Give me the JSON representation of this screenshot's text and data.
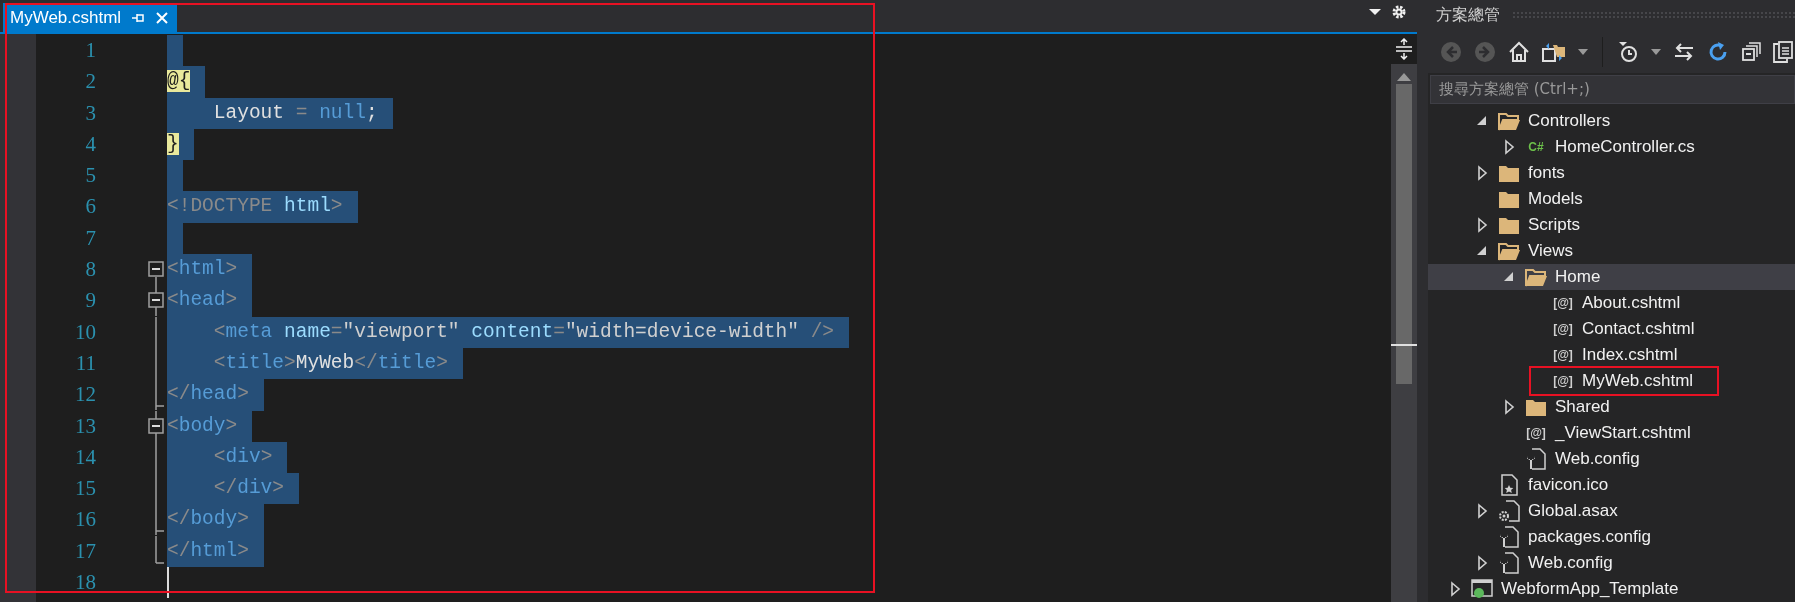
{
  "editor": {
    "tabs": [
      {
        "label": "MyWeb.cshtml",
        "selected": true
      }
    ],
    "highlighted": true,
    "lines": [
      {
        "number": "1",
        "selected": true
      },
      {
        "number": "2",
        "selected": true,
        "segments": [
          {
            "kind": "razor",
            "text": "@{"
          }
        ]
      },
      {
        "number": "3",
        "selected": true,
        "segments": [
          {
            "kind": "plain",
            "text": "    Layout"
          },
          {
            "kind": "punct",
            "text": " = "
          },
          {
            "kind": "keyword",
            "text": "null"
          },
          {
            "kind": "plain",
            "text": ";"
          }
        ]
      },
      {
        "number": "4",
        "selected": true,
        "segments": [
          {
            "kind": "razor",
            "text": "}"
          }
        ]
      },
      {
        "number": "5",
        "selected": true
      },
      {
        "number": "6",
        "selected": true,
        "segments": [
          {
            "kind": "punct",
            "text": "<!DOCTYPE "
          },
          {
            "kind": "attr",
            "text": "html"
          },
          {
            "kind": "punct",
            "text": ">"
          }
        ]
      },
      {
        "number": "7",
        "selected": true
      },
      {
        "number": "8",
        "selected": true,
        "fold": {
          "kind": "start"
        },
        "segments": [
          {
            "kind": "punct",
            "text": "<"
          },
          {
            "kind": "tag",
            "text": "html"
          },
          {
            "kind": "punct",
            "text": ">"
          }
        ]
      },
      {
        "number": "9",
        "selected": true,
        "fold": {
          "kind": "start"
        },
        "segments": [
          {
            "kind": "punct",
            "text": "<"
          },
          {
            "kind": "tag",
            "text": "head"
          },
          {
            "kind": "punct",
            "text": ">"
          }
        ]
      },
      {
        "number": "10",
        "selected": true,
        "fold": {
          "kind": "inner"
        },
        "segments": [
          {
            "kind": "punct",
            "text": "    <"
          },
          {
            "kind": "tag",
            "text": "meta"
          },
          {
            "kind": "attr",
            "text": " name"
          },
          {
            "kind": "punct",
            "text": "="
          },
          {
            "kind": "value",
            "text": "\"viewport\""
          },
          {
            "kind": "attr",
            "text": " content"
          },
          {
            "kind": "punct",
            "text": "="
          },
          {
            "kind": "value",
            "text": "\"width=device-width\""
          },
          {
            "kind": "punct",
            "text": " />"
          }
        ]
      },
      {
        "number": "11",
        "selected": true,
        "fold": {
          "kind": "inner"
        },
        "segments": [
          {
            "kind": "punct",
            "text": "    <"
          },
          {
            "kind": "tag",
            "text": "title"
          },
          {
            "kind": "punct",
            "text": ">"
          },
          {
            "kind": "plain",
            "text": "MyWeb"
          },
          {
            "kind": "punct",
            "text": "</"
          },
          {
            "kind": "tag",
            "text": "title"
          },
          {
            "kind": "punct",
            "text": ">"
          }
        ]
      },
      {
        "number": "12",
        "selected": true,
        "fold": {
          "kind": "end"
        },
        "segments": [
          {
            "kind": "punct",
            "text": "</"
          },
          {
            "kind": "tag",
            "text": "head"
          },
          {
            "kind": "punct",
            "text": ">"
          }
        ]
      },
      {
        "number": "13",
        "selected": true,
        "fold": {
          "kind": "start"
        },
        "segments": [
          {
            "kind": "punct",
            "text": "<"
          },
          {
            "kind": "tag",
            "text": "body"
          },
          {
            "kind": "punct",
            "text": ">"
          }
        ]
      },
      {
        "number": "14",
        "selected": true,
        "fold": {
          "kind": "inner"
        },
        "segments": [
          {
            "kind": "punct",
            "text": "    <"
          },
          {
            "kind": "tag",
            "text": "div"
          },
          {
            "kind": "punct",
            "text": ">"
          }
        ]
      },
      {
        "number": "15",
        "selected": true,
        "fold": {
          "kind": "inner"
        },
        "segments": [
          {
            "kind": "punct",
            "text": "    </"
          },
          {
            "kind": "tag",
            "text": "div"
          },
          {
            "kind": "punct",
            "text": ">"
          }
        ]
      },
      {
        "number": "16",
        "selected": true,
        "fold": {
          "kind": "end"
        },
        "segments": [
          {
            "kind": "punct",
            "text": "</"
          },
          {
            "kind": "tag",
            "text": "body"
          },
          {
            "kind": "punct",
            "text": ">"
          }
        ]
      },
      {
        "number": "17",
        "selected": true,
        "fold": {
          "kind": "end"
        },
        "segments": [
          {
            "kind": "punct",
            "text": "</"
          },
          {
            "kind": "tag",
            "text": "html"
          },
          {
            "kind": "punct",
            "text": ">"
          }
        ]
      },
      {
        "number": "18",
        "selected": false,
        "caret": true
      }
    ]
  },
  "solution_explorer": {
    "title": "方案總管",
    "search": {
      "placeholder": "搜尋方案總管 (Ctrl+;)"
    },
    "items": [
      {
        "label": "Controllers",
        "kind": "folder",
        "expanded": true,
        "selected": false,
        "children": [
          {
            "label": "HomeController.cs",
            "glyph": "C#",
            "expanded": false,
            "selected": false
          }
        ]
      },
      {
        "label": "fonts",
        "kind": "folder",
        "expanded": false,
        "selected": false
      },
      {
        "label": "Models",
        "kind": "folder",
        "selected": false
      },
      {
        "label": "Scripts",
        "kind": "folder",
        "expanded": false,
        "selected": false
      },
      {
        "label": "Views",
        "kind": "folder",
        "expanded": true,
        "selected": false,
        "children": [
          {
            "label": "Home",
            "kind": "folder",
            "expanded": true,
            "selected": true,
            "children": [
              {
                "label": "About.cshtml",
                "glyph": "[@]",
                "selected": false
              },
              {
                "label": "Contact.cshtml",
                "glyph": "[@]",
                "selected": false
              },
              {
                "label": "Index.cshtml",
                "glyph": "[@]",
                "selected": false
              },
              {
                "label": "MyWeb.cshtml",
                "glyph": "[@]",
                "selected": false,
                "highlighted": true
              }
            ]
          },
          {
            "label": "Shared",
            "kind": "folder",
            "expanded": false,
            "selected": false
          },
          {
            "label": "_ViewStart.cshtml",
            "glyph": "[@]",
            "selected": false
          },
          {
            "label": "Web.config",
            "kind": "config",
            "selected": false
          }
        ]
      },
      {
        "label": "favicon.ico",
        "kind": "image",
        "selected": false
      },
      {
        "label": "Global.asax",
        "kind": "settings",
        "expanded": false,
        "selected": false
      },
      {
        "label": "packages.config",
        "kind": "config",
        "selected": false
      },
      {
        "label": "Web.config",
        "kind": "config",
        "expanded": false,
        "selected": false
      }
    ],
    "next_project": {
      "label": "WebformApp_Template",
      "kind": "project",
      "expanded": false,
      "selected": false
    }
  }
}
